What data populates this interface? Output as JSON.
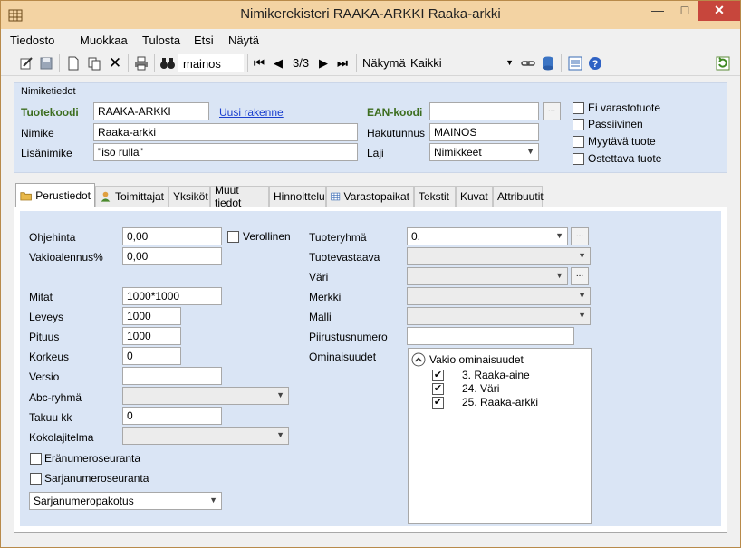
{
  "window": {
    "title": "Nimikerekisteri RAAKA-ARKKI Raaka-arkki"
  },
  "menu": [
    "Tiedosto",
    "Muokkaa",
    "Tulosta",
    "Etsi",
    "Näytä"
  ],
  "toolbar": {
    "search_value": "mainos",
    "record_position": "3/3",
    "view_label": "Näkymä",
    "view_value": "Kaikki"
  },
  "header": {
    "title": "Nimiketiedot",
    "tuotekoodi_label": "Tuotekoodi",
    "tuotekoodi_value": "RAAKA-ARKKI",
    "new_structure_link": "Uusi rakenne",
    "ean_label": "EAN-koodi",
    "ean_value": "",
    "nimike_label": "Nimike",
    "nimike_value": "Raaka-arkki",
    "hakutunnus_label": "Hakutunnus",
    "hakutunnus_value": "MAINOS",
    "lisanimike_label": "Lisänimike",
    "lisanimike_value": "\"iso rulla\"",
    "laji_label": "Laji",
    "laji_value": "Nimikkeet",
    "checkboxes": [
      "Ei varastotuote",
      "Passiivinen",
      "Myytävä tuote",
      "Ostettava tuote"
    ]
  },
  "tabs": [
    "Perustiedot",
    "Toimittajat",
    "Yksiköt",
    "Muut tiedot",
    "Hinnoittelu",
    "Varastopaikat",
    "Tekstit",
    "Kuvat",
    "Attribuutit"
  ],
  "basic": {
    "ohjehinta_label": "Ohjehinta",
    "ohjehinta_value": "0,00",
    "verollinen_label": "Verollinen",
    "vakioalennus_label": "Vakioalennus%",
    "vakioalennus_value": "0,00",
    "mitat_label": "Mitat",
    "mitat_value": "1000*1000",
    "leveys_label": "Leveys",
    "leveys_value": "1000",
    "pituus_label": "Pituus",
    "pituus_value": "1000",
    "korkeus_label": "Korkeus",
    "korkeus_value": "0",
    "versio_label": "Versio",
    "versio_value": "",
    "abc_label": "Abc-ryhmä",
    "abc_value": "",
    "takuu_label": "Takuu kk",
    "takuu_value": "0",
    "kokolajitelma_label": "Kokolajitelma",
    "kokolajitelma_value": "",
    "eranumero_label": "Eränumeroseuranta",
    "sarjanumero_label": "Sarjanumeroseuranta",
    "sarjanumeropakotus_value": "Sarjanumeropakotus"
  },
  "right": {
    "tuoteryhma_label": "Tuoteryhmä",
    "tuoteryhma_value": "0.",
    "tuotevastaava_label": "Tuotevastaava",
    "vari_label": "Väri",
    "merkki_label": "Merkki",
    "malli_label": "Malli",
    "piirustusnumero_label": "Piirustusnumero",
    "ominaisuudet_label": "Ominaisuudet",
    "tree_root": "Vakio ominaisuudet",
    "tree_items": [
      "3. Raaka-aine",
      "24. Väri",
      "25. Raaka-arkki"
    ]
  }
}
